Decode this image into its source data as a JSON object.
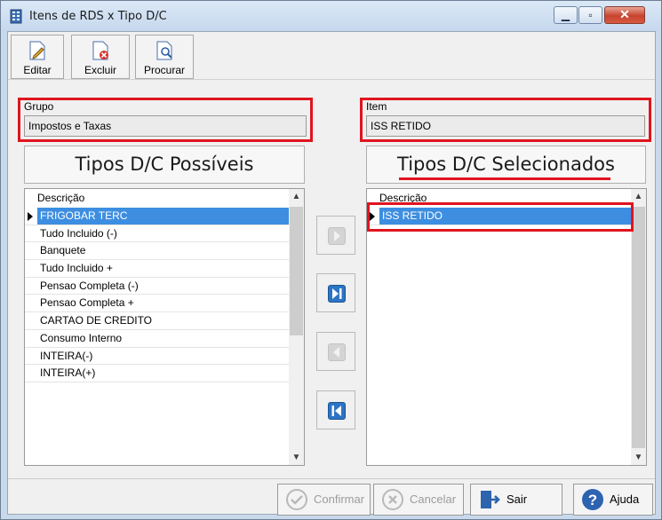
{
  "window": {
    "title": "Itens de RDS x Tipo D/C"
  },
  "toolbar": {
    "editar": "Editar",
    "excluir": "Excluir",
    "procurar": "Procurar"
  },
  "grupo": {
    "label": "Grupo",
    "value": "Impostos e Taxas"
  },
  "item": {
    "label": "Item",
    "value": "ISS RETIDO"
  },
  "left_list": {
    "title": "Tipos D/C Possíveis",
    "column": "Descrição",
    "rows": [
      "FRIGOBAR TERC",
      "Tudo Incluido (-)",
      "Banquete",
      "Tudo Incluido +",
      "Pensao Completa (-)",
      "Pensao Completa +",
      "CARTAO DE CREDITO",
      "Consumo Interno",
      "INTEIRA(-)",
      "INTEIRA(+)"
    ]
  },
  "right_list": {
    "title": "Tipos D/C Selecionados",
    "column": "Descrição",
    "rows": [
      "ISS RETIDO"
    ]
  },
  "buttons": {
    "confirmar": "Confirmar",
    "cancelar": "Cancelar",
    "sair": "Sair",
    "ajuda": "Ajuda"
  },
  "colors": {
    "highlight": "#e0141e",
    "selection": "#3d8ee0",
    "move_button": "#2d74c4"
  }
}
